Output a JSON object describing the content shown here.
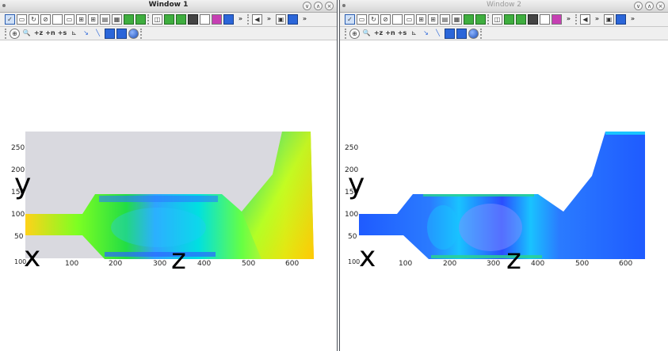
{
  "windows": [
    {
      "title": "Window 1",
      "style": "active"
    },
    {
      "title": "Window 2",
      "style": "inactive"
    }
  ],
  "titlebar_buttons": [
    "∨",
    "∧",
    "×"
  ],
  "toolbar_more": "»",
  "toolbar_row1_icons": [
    "checkbox-icon",
    "window-icon",
    "refresh-icon",
    "stop-icon",
    "square-icon",
    "rect-icon",
    "grid-2x2-icon",
    "grid-3x2-icon",
    "grid-2x1-icon",
    "grid-3x3-icon",
    "green-arrow-icon",
    "mesh-icon",
    "cube-icon",
    "green-cube-icon",
    "green-box-icon",
    "dark-box-icon",
    "light-box-icon",
    "magenta-box-icon",
    "blue-box-icon"
  ],
  "toolbar_row2_icons": [
    "target-icon",
    "zoom-icon",
    "axis-z-icon",
    "axis-n-icon",
    "axis-s-icon",
    "chart-icon",
    "pointer-icon",
    "line-icon",
    "cube-blue-icon",
    "box-blue-icon",
    "sphere-icon",
    "slider-icon"
  ],
  "axis_labels": {
    "y": "y",
    "x": "x",
    "z": "z"
  },
  "y_ticks": [
    "250",
    "200",
    "150",
    "100",
    "50",
    "100"
  ],
  "x_ticks": [
    "100",
    "200",
    "300",
    "400",
    "500",
    "600"
  ],
  "plot1": {
    "colors": [
      "#22dd44",
      "#88ff22",
      "#ffee22",
      "#00e0e0",
      "#2fa3ff",
      "#ffc020"
    ]
  },
  "plot2": {
    "colors": [
      "#1f5bff",
      "#2a7bff",
      "#19c3ff",
      "#2bd48c",
      "#7f8fff"
    ]
  }
}
